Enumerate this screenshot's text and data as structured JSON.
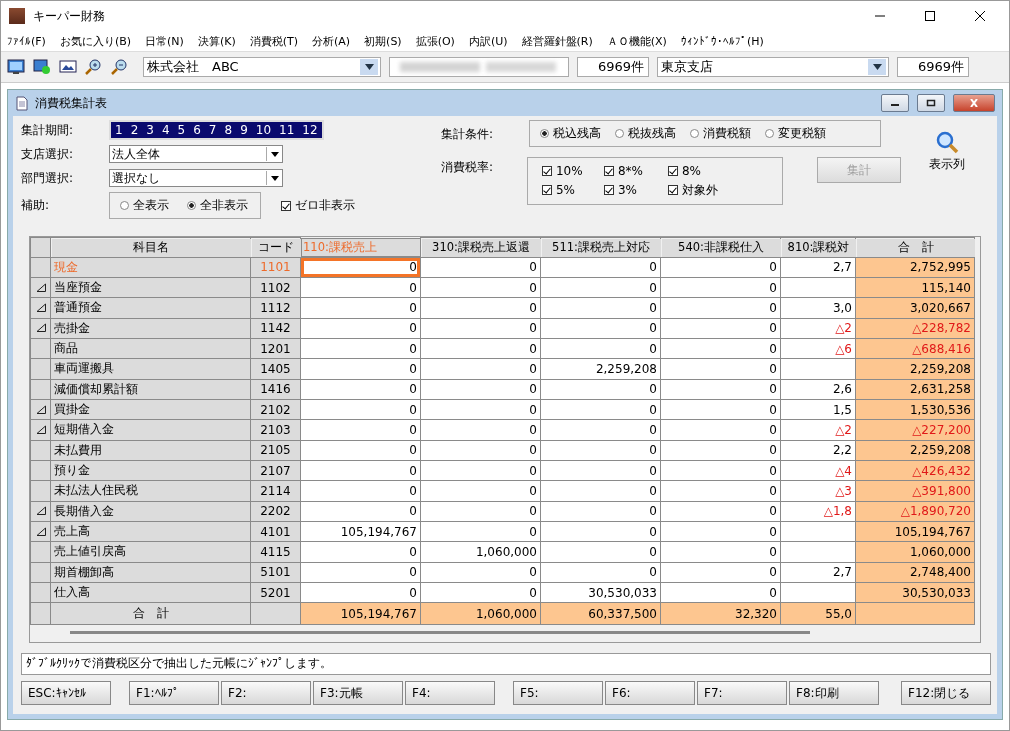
{
  "app": {
    "title": "キーパー財務"
  },
  "menu": [
    "ﾌｧｲﾙ(F)",
    "お気に入り(B)",
    "日常(N)",
    "決算(K)",
    "消費税(T)",
    "分析(A)",
    "初期(S)",
    "拡張(O)",
    "内訳(U)",
    "経営羅針盤(R)",
    "ＡＯ機能(X)",
    "ｳｨﾝﾄﾞｳ･ﾍﾙﾌﾟ(H)"
  ],
  "toolbar": {
    "company": "株式会社　ABC",
    "company_count": "6969件",
    "branch": "東京支店",
    "branch_count": "6969件"
  },
  "form_window": {
    "title": "消費税集計表"
  },
  "period": {
    "label": "集計期間:",
    "months": [
      {
        "label": "1",
        "selected": true
      },
      {
        "label": "2",
        "selected": true
      },
      {
        "label": "3",
        "selected": true
      },
      {
        "label": "4",
        "selected": true
      },
      {
        "label": "5",
        "selected": true
      },
      {
        "label": "6",
        "selected": true
      },
      {
        "label": "7",
        "selected": true
      },
      {
        "label": "8",
        "selected": true
      },
      {
        "label": "9",
        "selected": true
      },
      {
        "label": "10",
        "selected": true
      },
      {
        "label": "11",
        "selected": true
      },
      {
        "label": "12",
        "selected": true
      }
    ]
  },
  "branch_select": {
    "label": "支店選択:",
    "value": "法人全体"
  },
  "dept_select": {
    "label": "部門選択:",
    "value": "選択なし"
  },
  "aux": {
    "label": "補助:",
    "options": [
      {
        "label": "全表示",
        "selected": false
      },
      {
        "label": "全非表示",
        "selected": true
      }
    ]
  },
  "zero_hide": {
    "label": "ゼロ非表示",
    "checked": true
  },
  "condition": {
    "label": "集計条件:",
    "options": [
      {
        "label": "税込残高",
        "selected": true
      },
      {
        "label": "税抜残高",
        "selected": false
      },
      {
        "label": "消費税額",
        "selected": false
      },
      {
        "label": "変更税額",
        "selected": false
      }
    ]
  },
  "tax_rates": {
    "label": "消費税率:",
    "options": [
      {
        "label": "10%",
        "checked": true
      },
      {
        "label": "8*%",
        "checked": true
      },
      {
        "label": "8%",
        "checked": true
      },
      {
        "label": "5%",
        "checked": true
      },
      {
        "label": "3%",
        "checked": true
      },
      {
        "label": "対象外",
        "checked": true
      }
    ]
  },
  "aggregate_button": {
    "label": "集計",
    "disabled": true
  },
  "columns_button": {
    "label": "表示列"
  },
  "table": {
    "columns": [
      {
        "label": "科目名",
        "selected": false
      },
      {
        "label": "コード",
        "selected": false
      },
      {
        "label": "110:課税売上",
        "selected": true
      },
      {
        "label": "310:課税売上返還",
        "selected": false
      },
      {
        "label": "511:課税売上対応",
        "selected": false
      },
      {
        "label": "540:非課税仕入",
        "selected": false
      },
      {
        "label": "810:課税対",
        "selected": false
      },
      {
        "label": "合　計",
        "selected": false
      }
    ],
    "rows": [
      {
        "cells": [
          "現金",
          "1101",
          "0",
          "0",
          "0",
          "0",
          "2,7",
          "2,752,995"
        ],
        "expandable": false,
        "negative": false,
        "selected": true
      },
      {
        "cells": [
          "当座預金",
          "1102",
          "0",
          "0",
          "0",
          "0",
          "",
          "115,140"
        ],
        "expandable": true,
        "negative": false,
        "selected": false
      },
      {
        "cells": [
          "普通預金",
          "1112",
          "0",
          "0",
          "0",
          "0",
          "3,0",
          "3,020,667"
        ],
        "expandable": true,
        "negative": false,
        "selected": false
      },
      {
        "cells": [
          "売掛金",
          "1142",
          "0",
          "0",
          "0",
          "0",
          "△2",
          "△228,782"
        ],
        "expandable": true,
        "negative": true,
        "selected": false
      },
      {
        "cells": [
          "商品",
          "1201",
          "0",
          "0",
          "0",
          "0",
          "△6",
          "△688,416"
        ],
        "expandable": false,
        "negative": true,
        "selected": false
      },
      {
        "cells": [
          "車両運搬具",
          "1405",
          "0",
          "0",
          "2,259,208",
          "0",
          "",
          "2,259,208"
        ],
        "expandable": false,
        "negative": false,
        "selected": false
      },
      {
        "cells": [
          "減価償却累計額",
          "1416",
          "0",
          "0",
          "0",
          "0",
          "2,6",
          "2,631,258"
        ],
        "expandable": false,
        "negative": false,
        "selected": false
      },
      {
        "cells": [
          "買掛金",
          "2102",
          "0",
          "0",
          "0",
          "0",
          "1,5",
          "1,530,536"
        ],
        "expandable": true,
        "negative": false,
        "selected": false
      },
      {
        "cells": [
          "短期借入金",
          "2103",
          "0",
          "0",
          "0",
          "0",
          "△2",
          "△227,200"
        ],
        "expandable": true,
        "negative": true,
        "selected": false
      },
      {
        "cells": [
          "未払費用",
          "2105",
          "0",
          "0",
          "0",
          "0",
          "2,2",
          "2,259,208"
        ],
        "expandable": false,
        "negative": false,
        "selected": false
      },
      {
        "cells": [
          "預り金",
          "2107",
          "0",
          "0",
          "0",
          "0",
          "△4",
          "△426,432"
        ],
        "expandable": false,
        "negative": true,
        "selected": false
      },
      {
        "cells": [
          "未払法人住民税",
          "2114",
          "0",
          "0",
          "0",
          "0",
          "△3",
          "△391,800"
        ],
        "expandable": false,
        "negative": true,
        "selected": false
      },
      {
        "cells": [
          "長期借入金",
          "2202",
          "0",
          "0",
          "0",
          "0",
          "△1,8",
          "△1,890,720"
        ],
        "expandable": true,
        "negative": true,
        "selected": false
      },
      {
        "cells": [
          "売上高",
          "4101",
          "105,194,767",
          "0",
          "0",
          "0",
          "",
          "105,194,767"
        ],
        "expandable": true,
        "negative": false,
        "selected": false
      },
      {
        "cells": [
          "売上値引戻高",
          "4115",
          "0",
          "1,060,000",
          "0",
          "0",
          "",
          "1,060,000"
        ],
        "expandable": false,
        "negative": false,
        "selected": false
      },
      {
        "cells": [
          "期首棚卸高",
          "5101",
          "0",
          "0",
          "0",
          "0",
          "2,7",
          "2,748,400"
        ],
        "expandable": false,
        "negative": false,
        "selected": false
      },
      {
        "cells": [
          "仕入高",
          "5201",
          "0",
          "0",
          "30,530,033",
          "0",
          "",
          "30,530,033"
        ],
        "expandable": false,
        "negative": false,
        "selected": false
      }
    ],
    "total_row": {
      "label": "合　計",
      "cells": [
        "105,194,767",
        "1,060,000",
        "60,337,500",
        "32,320",
        "55,0"
      ]
    }
  },
  "message": "ﾀﾞﾌﾞﾙｸﾘｯｸで消費税区分で抽出した元帳にｼﾞｬﾝﾌﾟします。",
  "function_keys": [
    [
      {
        "label": "ESC:ｷｬﾝｾﾙ"
      }
    ],
    [
      {
        "label": "F1:ﾍﾙﾌﾟ"
      },
      {
        "label": "F2:"
      },
      {
        "label": "F3:元帳"
      },
      {
        "label": "F4:"
      }
    ],
    [
      {
        "label": "F5:"
      },
      {
        "label": "F6:"
      },
      {
        "label": "F7:"
      },
      {
        "label": "F8:印刷"
      }
    ],
    [
      {
        "label": "F12:閉じる"
      }
    ]
  ]
}
